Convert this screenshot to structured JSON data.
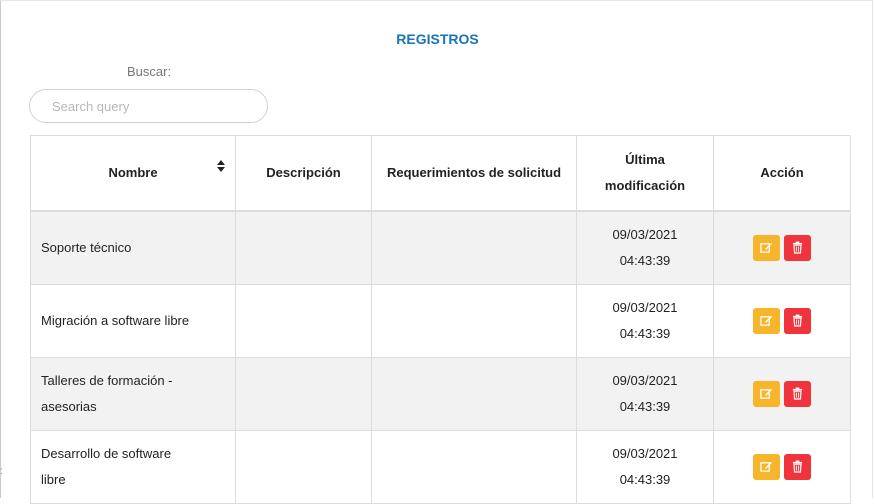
{
  "header": {
    "title": "REGISTROS"
  },
  "search": {
    "label": "Buscar:",
    "placeholder": "Search query"
  },
  "table": {
    "columns": [
      "Nombre",
      "Descripción",
      "Requerimientos de solicitud",
      "Última modificación",
      "Acción"
    ],
    "rows": [
      {
        "nombre": "Soporte técnico",
        "descripcion": "",
        "requerimientos": "",
        "fecha": "09/03/2021",
        "hora": "04:43:39"
      },
      {
        "nombre": "Migración a software libre",
        "descripcion": "",
        "requerimientos": "",
        "fecha": "09/03/2021",
        "hora": "04:43:39"
      },
      {
        "nombre": "Talleres de formación - asesorias",
        "descripcion": "",
        "requerimientos": "",
        "fecha": "09/03/2021",
        "hora": "04:43:39"
      },
      {
        "nombre": "Desarrollo de software libre",
        "descripcion": "",
        "requerimientos": "",
        "fecha": "09/03/2021",
        "hora": "04:43:39"
      }
    ]
  },
  "icons": {
    "edit": "edit-icon",
    "delete": "trash-icon"
  },
  "colors": {
    "title": "#1a73b5",
    "edit_button": "#f7b52c",
    "delete_button": "#f1343b",
    "stripe": "#f2f2f2"
  }
}
